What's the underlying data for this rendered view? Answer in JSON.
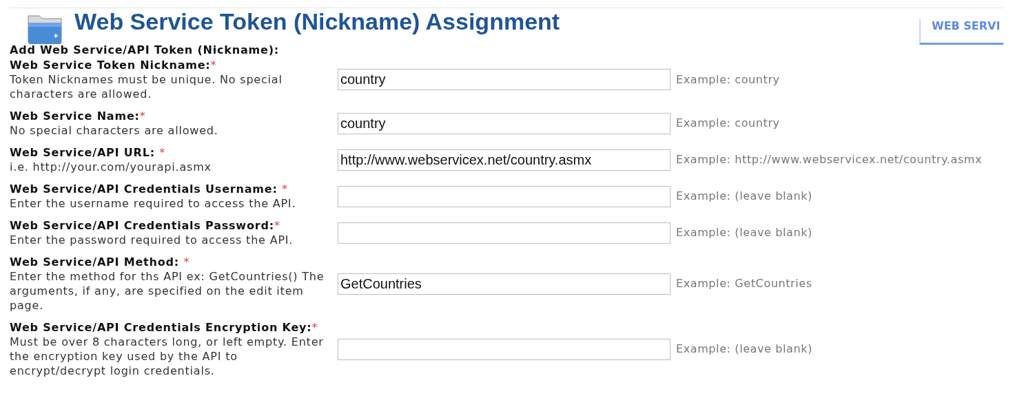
{
  "page_title": "Web Service Token (Nickname) Assignment",
  "tab": {
    "label": "WEB SERVI",
    "selected": true
  },
  "form": {
    "heading": "Add Web Service/API Token (Nickname):",
    "fields": [
      {
        "label": "Web Service Token Nickname:",
        "required_mark": "*",
        "help": "Token Nicknames must be unique. No special characters are allowed.",
        "value": "country",
        "example": "Example: country"
      },
      {
        "label": "Web Service Name:",
        "required_mark": "*",
        "help": "No special characters are allowed.",
        "value": "country",
        "example": "Example: country"
      },
      {
        "label": "Web Service/API URL: ",
        "required_mark": "*",
        "help": "i.e. http://your.com/yourapi.asmx",
        "value": "http://www.webservicex.net/country.asmx",
        "example": "Example: http://www.webservicex.net/country.asmx"
      },
      {
        "label": "Web Service/API Credentials Username: ",
        "required_mark": "*",
        "help": "Enter the username required to access the API.",
        "example": "Example: (leave blank)"
      },
      {
        "label": "Web Service/API Credentials Password:",
        "required_mark": "*",
        "help": "Enter the password required to access the API.",
        "example": "Example: (leave blank)"
      },
      {
        "label": "Web Service/API Method: ",
        "required_mark": "*",
        "help": "Enter the method for ths API ex: GetCountries() The arguments, if any, are specified on the edit item page.",
        "value": "GetCountries",
        "example": "Example: GetCountries"
      },
      {
        "label": "Web Service/API Credentials Encryption Key:",
        "required_mark": "*",
        "help": "Must be over 8 characters long, or left empty. Enter the encryption key used by the API to encrypt/decrypt login credentials.",
        "example": "Example: (leave blank)"
      }
    ]
  }
}
